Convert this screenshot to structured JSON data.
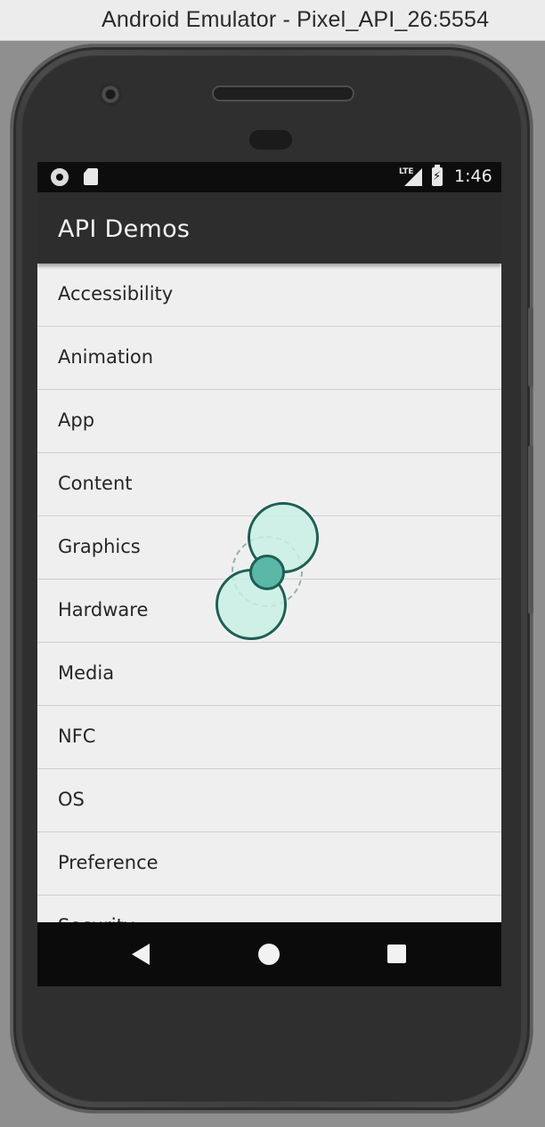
{
  "window": {
    "title": "Android Emulator - Pixel_API_26:5554"
  },
  "status_bar": {
    "network": "LTE",
    "time": "1:46"
  },
  "app_bar": {
    "title": "API Demos"
  },
  "list": {
    "items": [
      {
        "label": "Accessibility"
      },
      {
        "label": "Animation"
      },
      {
        "label": "App"
      },
      {
        "label": "Content"
      },
      {
        "label": "Graphics"
      },
      {
        "label": "Hardware"
      },
      {
        "label": "Media"
      },
      {
        "label": "NFC"
      },
      {
        "label": "OS"
      },
      {
        "label": "Preference"
      },
      {
        "label": "Security"
      }
    ]
  },
  "nav_bar": {
    "back_icon": "triangle-back-icon",
    "home_icon": "circle-home-icon",
    "recents_icon": "square-recents-icon"
  },
  "colors": {
    "app_bar": "#2d2d2d",
    "list_background": "#efefef",
    "touch_indicator": "#5bb7a6"
  }
}
